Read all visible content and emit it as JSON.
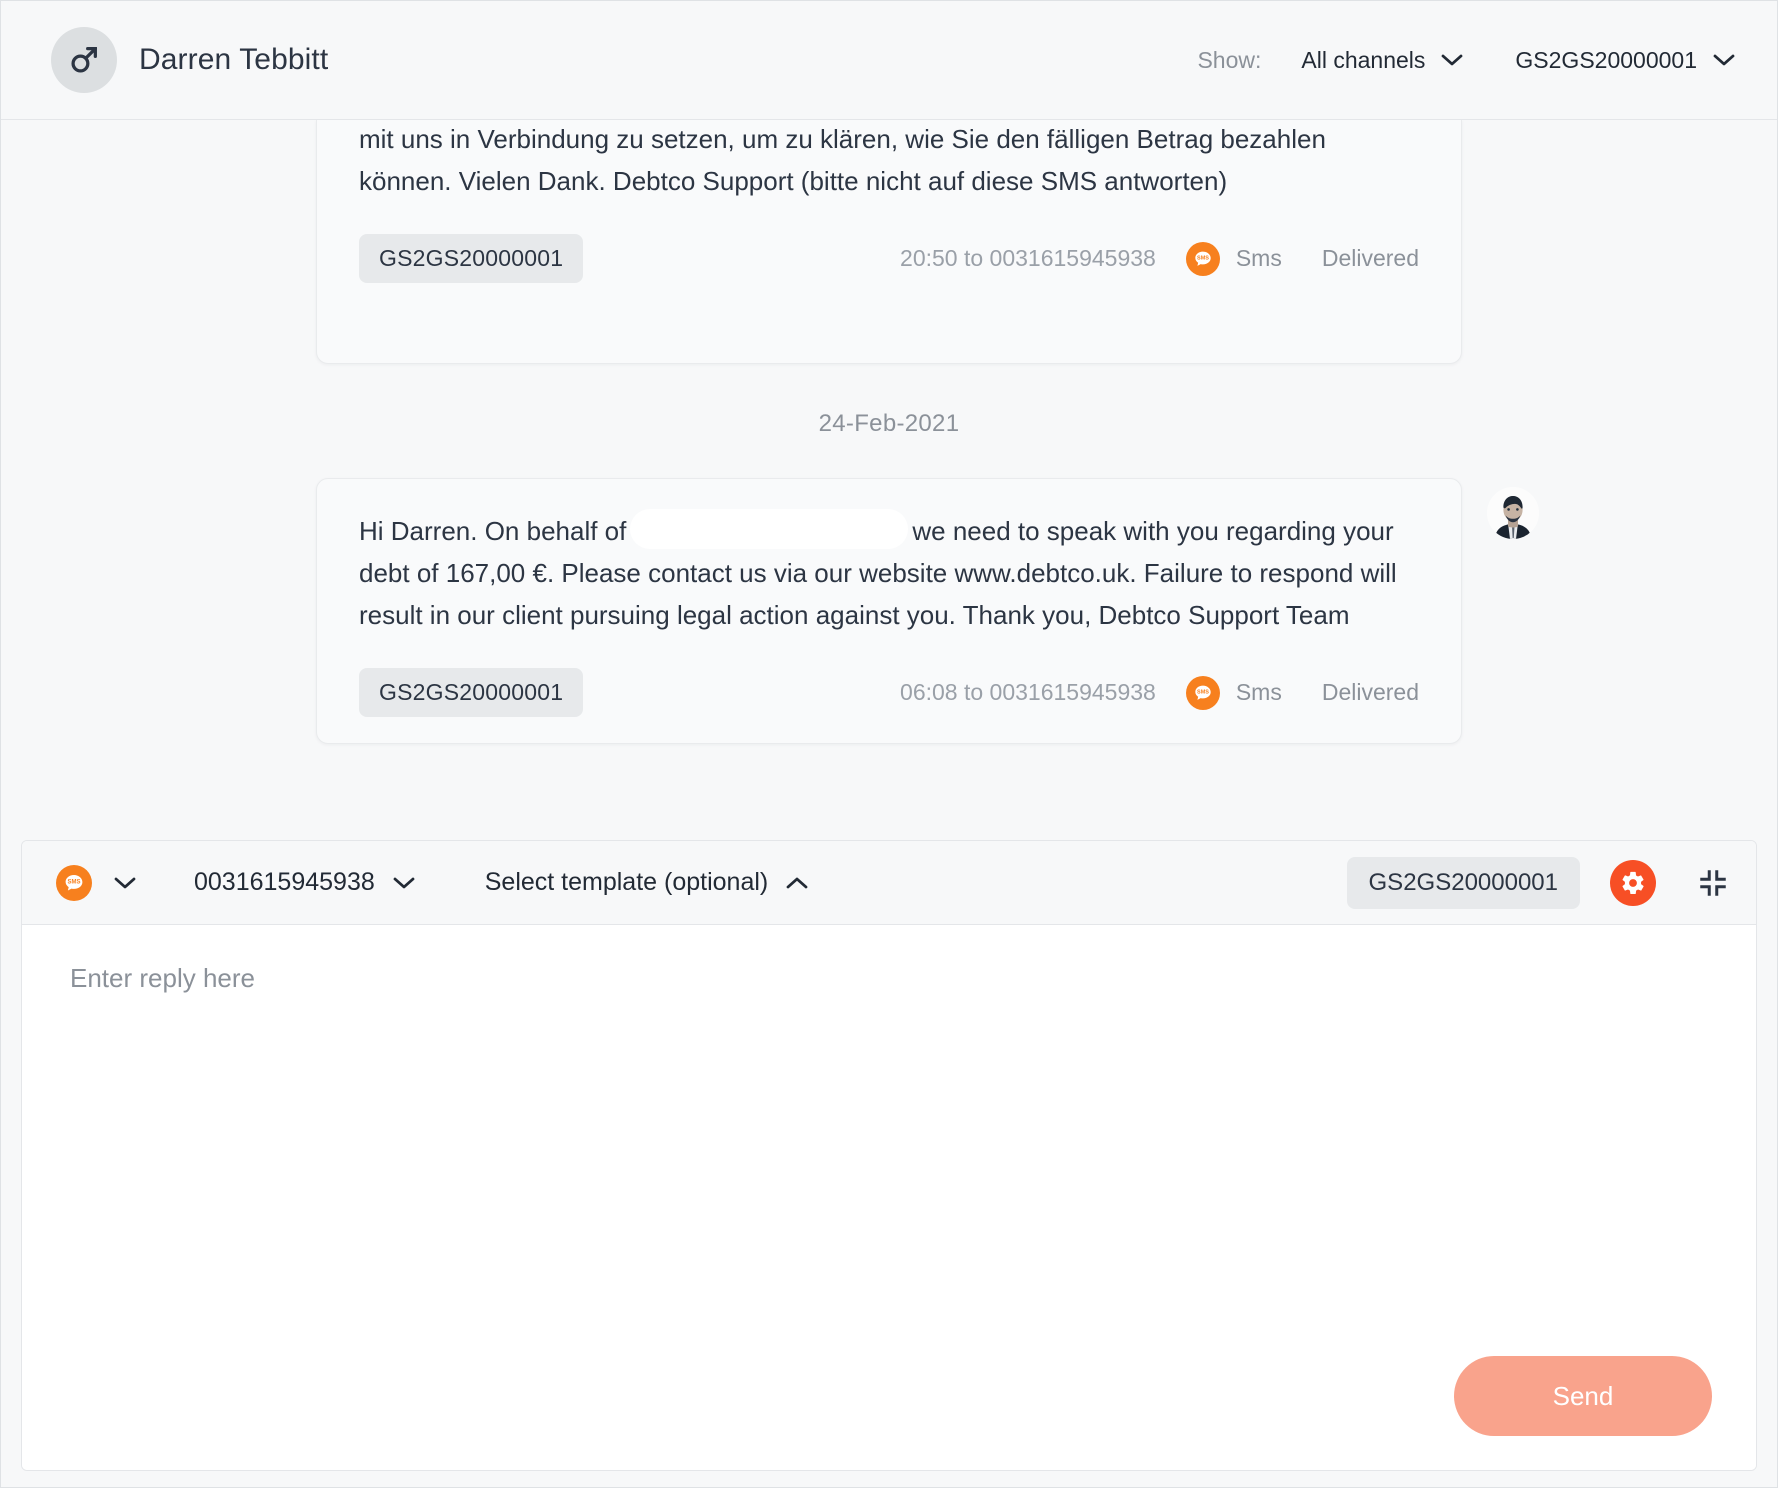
{
  "header": {
    "avatar_icon": "male-gender-icon",
    "contact_name": "Darren Tebbitt",
    "show_label": "Show:",
    "channel_filter": "All channels",
    "reference_filter": "GS2GS20000001",
    "chevron_icon": "chevron-down-icon"
  },
  "conversation": {
    "messages": [
      {
        "text": "jedoch haben wir nichts von Ihnen gehört. Wir bitten Sie, sich wie in der E-Mail beschrieben mit uns in Verbindung zu setzen, um zu klären, wie Sie den fälligen Betrag bezahlen können. Vielen Dank. Debtco Support (bitte nicht auf diese SMS antworten)",
        "reference": "GS2GS20000001",
        "time_to": "20:50 to 0031615945938",
        "channel": "Sms",
        "channel_icon": "sms-bubble-icon",
        "status": "Delivered"
      },
      {
        "text_before_redaction": "Hi Darren. On behalf of",
        "text_after_redaction": "we need to speak with you regarding your debt of 167,00 €. Please contact us via our website www.debtco.uk. Failure to respond will result in our client pursuing legal action against you. Thank you, Debtco Support Team",
        "reference": "GS2GS20000001",
        "time_to": "06:08 to 0031615945938",
        "channel": "Sms",
        "channel_icon": "sms-bubble-icon",
        "status": "Delivered",
        "agent_avatar_icon": "agent-photo-avatar"
      }
    ],
    "date_separator": "24-Feb-2021"
  },
  "composer": {
    "channel_icon": "sms-bubble-icon",
    "channel_chevron_icon": "chevron-down-icon",
    "phone_number": "0031615945938",
    "phone_chevron_icon": "chevron-down-icon",
    "template_select": "Select template (optional)",
    "template_chevron_icon": "chevron-up-icon",
    "reference": "GS2GS20000001",
    "settings_icon": "gear-icon",
    "collapse_icon": "collapse-icon",
    "reply_placeholder": "Enter reply here",
    "reply_value": "",
    "send_label": "Send"
  },
  "colors": {
    "accent_orange": "#F7801E",
    "accent_red": "#F74F25",
    "send_button": "#F9A38C",
    "page_background": "#F7F8F9",
    "text_dark": "#2C3543",
    "text_muted": "#8B9199"
  }
}
